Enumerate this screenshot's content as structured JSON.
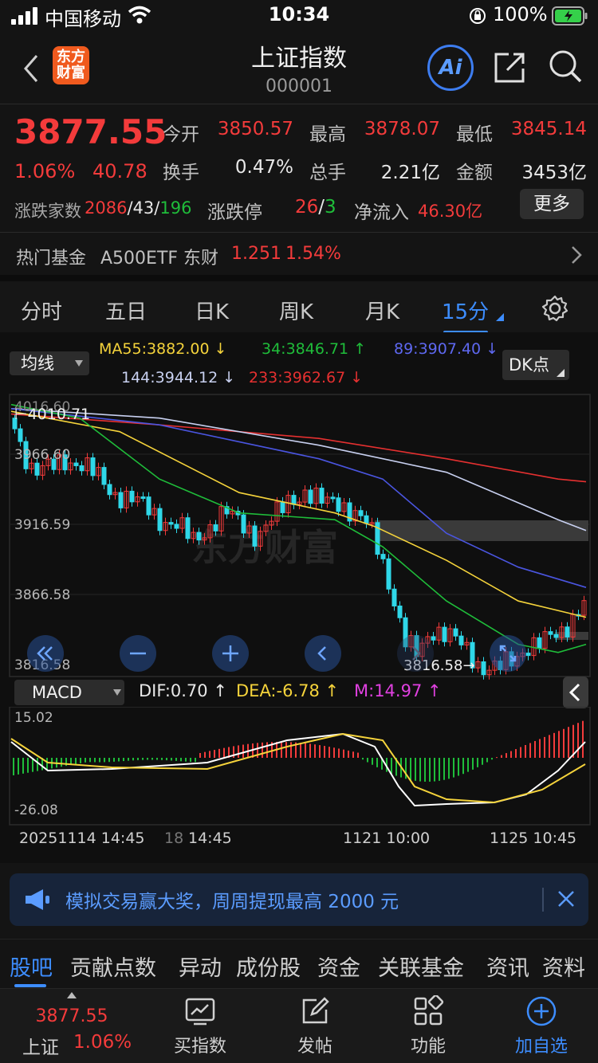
{
  "status_bar": {
    "carrier": "中国移动",
    "time": "10:34",
    "battery": "100%"
  },
  "header": {
    "logo_text_1": "东方",
    "logo_text_2": "财富",
    "title": "上证指数",
    "code": "000001",
    "ai_label": "Ai"
  },
  "quote": {
    "price": "3877.55",
    "change_pct": "1.06%",
    "change": "40.78",
    "open_label": "今开",
    "open": "3850.57",
    "high_label": "最高",
    "high": "3878.07",
    "low_label": "最低",
    "low": "3845.14",
    "turnover_label": "换手",
    "turnover": "0.47%",
    "volume_label": "总手",
    "volume": "2.21亿",
    "amount_label": "金额",
    "amount": "3453亿",
    "breadth_label": "涨跌家数",
    "breadth_up": "2086",
    "breadth_flat": "43",
    "breadth_down": "196",
    "limit_label": "涨跌停",
    "limit_up": "26",
    "limit_down": "3",
    "inflow_label": "净流入",
    "inflow": "46.30亿",
    "more_label": "更多",
    "slash": "/"
  },
  "fund": {
    "label": "热门基金",
    "name": "A500ETF 东财",
    "price": "1.251",
    "pct": "1.54%"
  },
  "period_tabs": [
    "分时",
    "五日",
    "日K",
    "周K",
    "月K",
    "15分"
  ],
  "chart_controls": {
    "ma_button": "均线",
    "dk_button": "DK点",
    "macd_button": "MACD"
  },
  "ma_values": {
    "ma55": "MA55:3882.00 ↓",
    "ma34": "34:3846.71 ↑",
    "ma89": "89:3907.40 ↓",
    "ma144": "144:3944.12 ↓",
    "ma233": "233:3962.67 ↓"
  },
  "macd_values": {
    "dif": "DIF:0.70 ↑",
    "dea": "DEA:-6.78 ↑",
    "m": "M:14.97 ↑"
  },
  "axis": {
    "y_top": "4016.60",
    "y2": "3966.60",
    "y3": "3916.59",
    "y4": "3866.58",
    "y_bottom": "3816.58",
    "high_marker": "4010.71",
    "low_marker": "3816.58",
    "macd_top": "15.02",
    "macd_bottom": "-26.08",
    "date1": "20251114 14:45",
    "date1_partial": "18",
    "date2": "14:45",
    "date3": "1121 10:00",
    "date4": "1125 10:45"
  },
  "watermark": "东方财富",
  "banner": {
    "text": "模拟交易赢大奖，周周提现最高 2000 元"
  },
  "section_tabs": [
    "股吧",
    "贡献点数",
    "异动",
    "成份股",
    "资金",
    "关联基金",
    "资讯",
    "资料"
  ],
  "bottom_bar": {
    "index_price": "3877.55",
    "index_name": "上证",
    "index_pct": "1.06%",
    "buy_label": "买指数",
    "post_label": "发帖",
    "func_label": "功能",
    "add_label": "加自选"
  },
  "colors": {
    "up": "#f33b3b",
    "down": "#1fbd3a",
    "accent": "#3d8dff",
    "ma55": "#f5d33b",
    "ma34": "#1fbd3a",
    "ma89": "#4a55e0",
    "ma144": "#c8d0f0",
    "ma233": "#e53030"
  }
}
